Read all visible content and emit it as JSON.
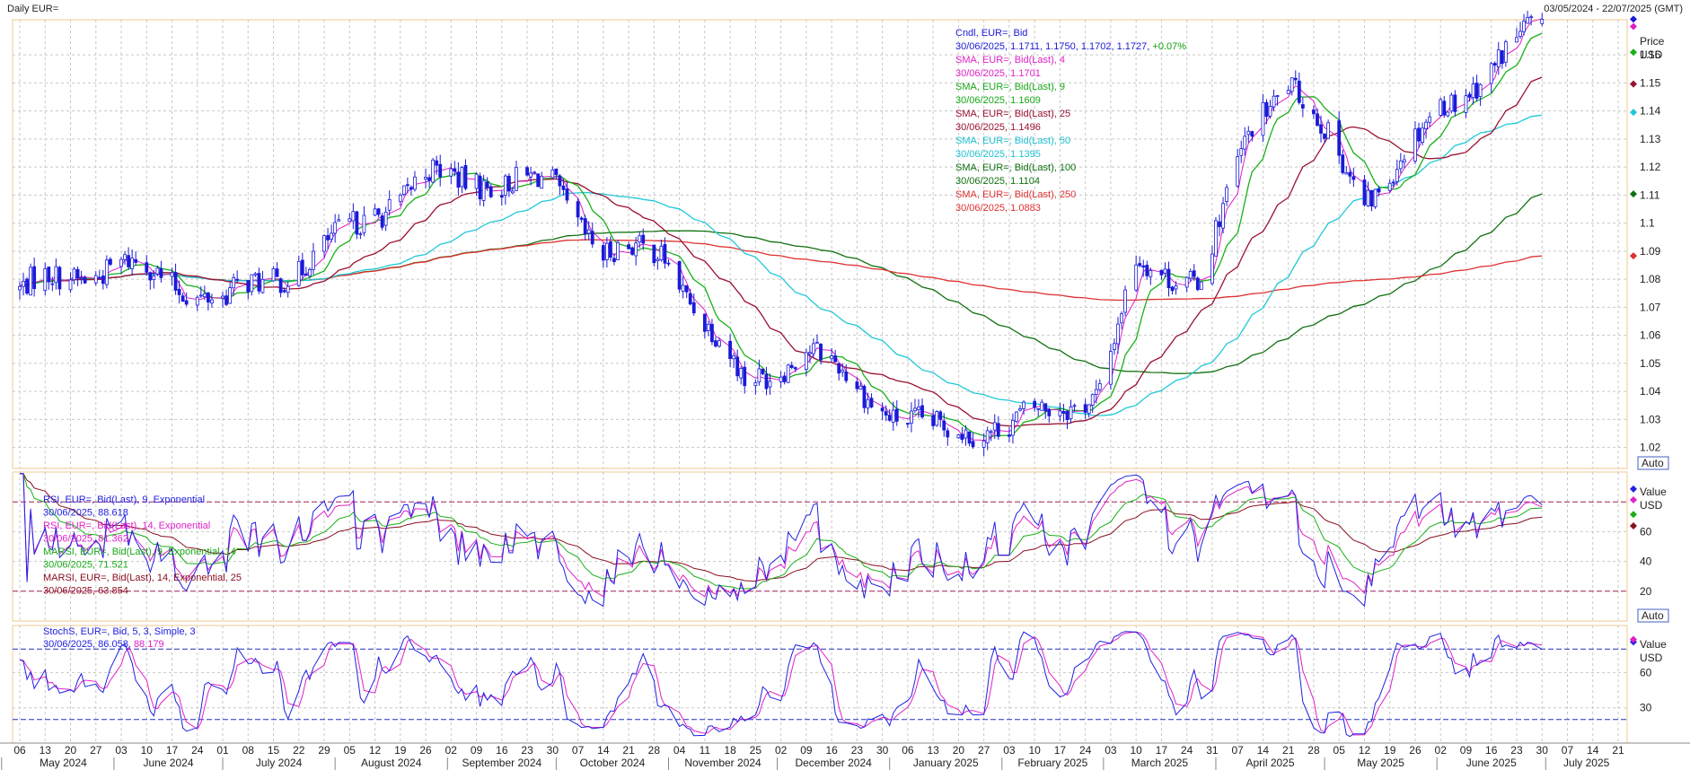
{
  "header": {
    "title": "Daily EUR=",
    "date_range": "03/05/2024 - 22/07/2025 (GMT)"
  },
  "colors": {
    "candle": "#1a1ad8",
    "sma4": "#e020c8",
    "sma9": "#1ab01a",
    "sma25": "#9a1030",
    "sma50": "#20c8d8",
    "sma100": "#107010",
    "sma250": "#e03030",
    "rsi9": "#2020e0",
    "rsi14": "#e020c8",
    "marsi9": "#18b018",
    "marsi14": "#8a1020",
    "stoch_k": "#2020e0",
    "stoch_d": "#e020c8",
    "grid": "#c8c8c8",
    "panel_border": "#f0c890"
  },
  "price_panel": {
    "axis_unit_title": "Price",
    "axis_unit": "USD",
    "auto_label": "Auto",
    "legend": [
      {
        "text": "Cndl, EUR=, Bid",
        "color": "#1a1ad8"
      },
      {
        "text": "30/06/2025, 1.1711, 1.1750, 1.1702, 1.1727, +0.07%",
        "color": "#1a1ad8",
        "suffix": "+0.07%",
        "suffix_color": "#10a010"
      },
      {
        "text": "SMA, EUR=, Bid(Last), 4",
        "color": "#e020c8"
      },
      {
        "text": "30/06/2025, 1.1701",
        "color": "#e020c8"
      },
      {
        "text": "SMA, EUR=, Bid(Last), 9",
        "color": "#18a818"
      },
      {
        "text": "30/06/2025, 1.1609",
        "color": "#18a818"
      },
      {
        "text": "SMA, EUR=, Bid(Last), 25",
        "color": "#9a1030"
      },
      {
        "text": "30/06/2025, 1.1496",
        "color": "#9a1030"
      },
      {
        "text": "SMA, EUR=, Bid(Last), 50",
        "color": "#20c0d0"
      },
      {
        "text": "30/06/2025, 1.1395",
        "color": "#20c0d0"
      },
      {
        "text": "SMA, EUR=, Bid(Last), 100",
        "color": "#107010"
      },
      {
        "text": "30/06/2025, 1.1104",
        "color": "#107010"
      },
      {
        "text": "SMA, EUR=, Bid(Last), 250",
        "color": "#e03030"
      },
      {
        "text": "30/06/2025, 1.0883",
        "color": "#e03030"
      }
    ],
    "y_ticks": [
      "1.16",
      "1.15",
      "1.14",
      "1.13",
      "1.12",
      "1.11",
      "1.1",
      "1.09",
      "1.08",
      "1.07",
      "1.06",
      "1.05",
      "1.04",
      "1.03",
      "1.02"
    ]
  },
  "rsi_panel": {
    "axis_unit_title": "Value",
    "axis_unit": "USD",
    "auto_label": "Auto",
    "legend": [
      {
        "text": "RSI, EUR=, Bid(Last), 9, Exponential",
        "color": "#2020e0"
      },
      {
        "text": "30/06/2025, 88.618",
        "color": "#2020e0"
      },
      {
        "text": "RSI, EUR=, Bid(Last), 14, Exponential",
        "color": "#e020c8"
      },
      {
        "text": "30/06/2025, 81.362",
        "color": "#e020c8"
      },
      {
        "text": "MARSI, EUR=, Bid(Last), 9, Exponential, 14",
        "color": "#18a818"
      },
      {
        "text": "30/06/2025, 71.521",
        "color": "#18a818"
      },
      {
        "text": "MARSI, EUR=, Bid(Last), 14, Exponential, 25",
        "color": "#8a1020"
      },
      {
        "text": "30/06/2025, 63.854",
        "color": "#8a1020"
      }
    ],
    "y_ticks": [
      "60",
      "40",
      "20"
    ]
  },
  "stoch_panel": {
    "axis_unit_title": "Value",
    "axis_unit": "USD",
    "auto_label": "Auto",
    "legend": [
      {
        "text": "StochS, EUR=, Bid, 5, 3, Simple, 3",
        "color": "#2020e0"
      },
      {
        "text": "30/06/2025, 86.058, 88.179",
        "color": "#2020e0",
        "suffix": "88.179",
        "suffix_color": "#e020c8"
      }
    ],
    "y_ticks": [
      "60",
      "30"
    ]
  },
  "x_axis": {
    "day_labels": [
      "06",
      "13",
      "20",
      "27",
      "03",
      "10",
      "17",
      "24",
      "01",
      "08",
      "15",
      "22",
      "29",
      "05",
      "12",
      "19",
      "26",
      "02",
      "09",
      "16",
      "23",
      "30",
      "07",
      "14",
      "21",
      "28",
      "04",
      "11",
      "18",
      "25",
      "02",
      "09",
      "16",
      "23",
      "30",
      "06",
      "13",
      "20",
      "27",
      "03",
      "10",
      "17",
      "24",
      "03",
      "10",
      "17",
      "24",
      "31",
      "07",
      "14",
      "21",
      "28",
      "05",
      "12",
      "19",
      "26",
      "02",
      "09",
      "16",
      "23",
      "30",
      "07",
      "14",
      "21"
    ],
    "month_labels": [
      "May 2024",
      "June 2024",
      "July 2024",
      "August 2024",
      "September 2024",
      "October 2024",
      "November 2024",
      "December 2024",
      "January 2025",
      "February 2025",
      "March 2025",
      "April 2025",
      "May 2025",
      "June 2025",
      "July 2025"
    ]
  },
  "chart_data": {
    "type": "line",
    "title": "Daily EUR=",
    "x_start": "2024-05-06",
    "x_end": "2025-07-21",
    "anchor_dates": [
      "2024-05-06",
      "2024-06-03",
      "2024-07-01",
      "2024-07-22",
      "2024-08-26",
      "2024-09-30",
      "2024-10-14",
      "2024-10-31",
      "2024-11-08",
      "2024-11-22",
      "2024-12-09",
      "2025-01-02",
      "2025-01-13",
      "2025-02-03",
      "2025-02-28",
      "2025-03-10",
      "2025-03-28",
      "2025-04-11",
      "2025-04-21",
      "2025-05-12",
      "2025-06-02",
      "2025-06-30"
    ],
    "anchor_close": [
      1.0765,
      1.0855,
      1.0725,
      1.0845,
      1.1165,
      1.1135,
      1.09,
      1.0885,
      1.072,
      1.042,
      1.0555,
      1.032,
      1.026,
      1.028,
      1.04,
      1.085,
      1.08,
      1.135,
      1.152,
      1.108,
      1.14,
      1.1727
    ],
    "series": [
      {
        "name": "Cndl, EUR=, Bid",
        "kind": "candle"
      },
      {
        "name": "SMA, EUR=, Bid(Last), 4",
        "period": 4,
        "last": 1.1701
      },
      {
        "name": "SMA, EUR=, Bid(Last), 9",
        "period": 9,
        "last": 1.1609
      },
      {
        "name": "SMA, EUR=, Bid(Last), 25",
        "period": 25,
        "last": 1.1496
      },
      {
        "name": "SMA, EUR=, Bid(Last), 50",
        "period": 50,
        "last": 1.1395
      },
      {
        "name": "SMA, EUR=, Bid(Last), 100",
        "period": 100,
        "last": 1.1104
      },
      {
        "name": "SMA, EUR=, Bid(Last), 250",
        "period": 250,
        "last": 1.0883
      }
    ],
    "last_bar": {
      "date": "2025-06-30",
      "open": 1.1711,
      "high": 1.175,
      "low": 1.1702,
      "close": 1.1727,
      "change_pct": "+0.07%"
    },
    "price_ylim": [
      1.0125,
      1.1725
    ],
    "rsi_ylim": [
      0,
      100
    ],
    "rsi_levels": [
      80,
      20
    ],
    "stoch_ylim": [
      0,
      100
    ],
    "stoch_levels": [
      80,
      20
    ],
    "rsi_last": {
      "rsi9": 88.618,
      "rsi14": 81.362,
      "marsi9": 71.521,
      "marsi14": 63.854
    },
    "stoch_last": {
      "k": 86.058,
      "d": 88.179
    },
    "grid": true
  }
}
